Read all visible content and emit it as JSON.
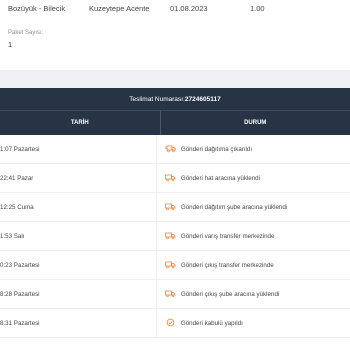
{
  "info": {
    "route": "Bozüyük - Bilecik",
    "agency": "Kuzeytepe Acente",
    "date": "01.08.2023",
    "weight": "1.00",
    "package_label": "Paket Sayısı:",
    "package_count": "1"
  },
  "table": {
    "tracking_label": "Teslimat Numarası:",
    "tracking_no": "2724605117",
    "col_date": "TARİH",
    "col_status": "DURUM",
    "rows": [
      {
        "date": "1:07 Pazartesi",
        "status": "Gönderi dağıtıma çıkarıldı",
        "icon": "truck-fast-icon"
      },
      {
        "date": "22:41 Pazar",
        "status": "Gönderi hat aracına yüklendi",
        "icon": "truck-icon"
      },
      {
        "date": "12:25 Cuma",
        "status": "Gönderi dağıtım şube aracına yüklendi",
        "icon": "truck-icon"
      },
      {
        "date": "1:53 Salı",
        "status": "Gönderi varış transfer merkezinde",
        "icon": "truck-icon"
      },
      {
        "date": "0:23 Pazartesi",
        "status": "Gönderi çıkış transfer merkezinde",
        "icon": "truck-icon"
      },
      {
        "date": "8:28 Pazartesi",
        "status": "Gönderi çıkış şube aracına yüklendi",
        "icon": "truck-icon"
      },
      {
        "date": "8:31 Pazartesi",
        "status": "Gönderi kabulü yapıldı",
        "icon": "check-badge-icon"
      }
    ]
  },
  "colors": {
    "header_bg": "#273445",
    "icon_accent": "#f07d2a"
  }
}
